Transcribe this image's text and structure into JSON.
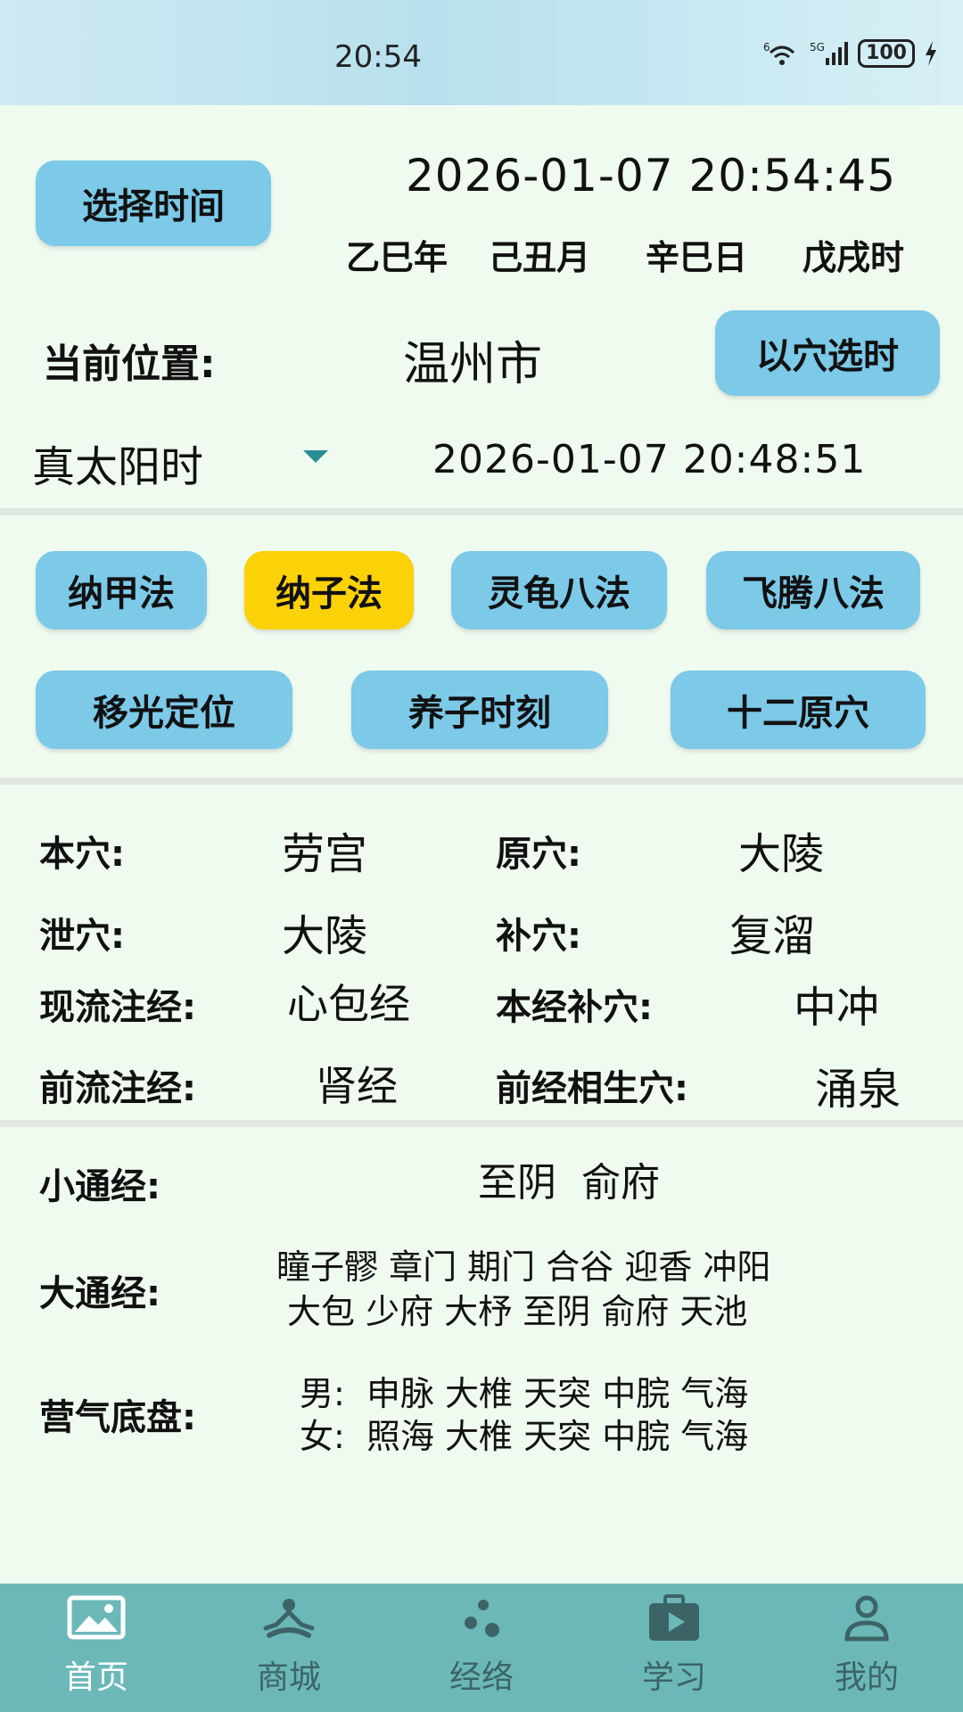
{
  "status": {
    "time": "20:54",
    "network": "5G",
    "wifi": "6",
    "battery": "100"
  },
  "header": {
    "select_time_button": "选择时间",
    "datetime": "2026-01-07 20:54:45",
    "ganzhi": [
      "乙巳年",
      "己丑月",
      "辛巳日",
      "戊戌时"
    ],
    "location_label": "当前位置:",
    "location_value": "温州市",
    "select_by_point_button": "以穴选时",
    "time_mode": "真太阳时",
    "solar_datetime": "2026-01-07 20:48:51"
  },
  "methods": {
    "row1": [
      "纳甲法",
      "纳子法",
      "灵龟八法",
      "飞腾八法"
    ],
    "row2": [
      "移光定位",
      "养子时刻",
      "十二原穴"
    ],
    "selected": "纳子法"
  },
  "points": [
    {
      "label": "本穴:",
      "value": "劳宫",
      "label2": "原穴:",
      "value2": "大陵"
    },
    {
      "label": "泄穴:",
      "value": "大陵",
      "label2": "补穴:",
      "value2": "复溜"
    },
    {
      "label": "现流注经:",
      "value": "心包经",
      "label2": "本经补穴:",
      "value2": "中冲"
    },
    {
      "label": "前流注经:",
      "value": "肾经",
      "label2": "前经相生穴:",
      "value2": "涌泉"
    }
  ],
  "meridians": {
    "small_label": "小通经:",
    "small_value": "至阴  俞府",
    "big_label": "大通经:",
    "big_line1": "瞳子髎 章门 期门 合谷 迎香 冲阳",
    "big_line2": "大包 少府 大杼 至阴 俞府 天池",
    "ying_label": "营气底盘:",
    "ying_male": "男:  申脉 大椎 天突 中脘 气海",
    "ying_female": "女:  照海 大椎 天突 中脘 气海"
  },
  "nav": [
    {
      "label": "首页",
      "icon": "home-image-icon",
      "active": true
    },
    {
      "label": "商城",
      "icon": "meditation-icon",
      "active": false
    },
    {
      "label": "经络",
      "icon": "dots-icon",
      "active": false
    },
    {
      "label": "学习",
      "icon": "play-briefcase-icon",
      "active": false
    },
    {
      "label": "我的",
      "icon": "person-icon",
      "active": false
    }
  ],
  "colors": {
    "button": "#7cc9e8",
    "selected": "#fbd107",
    "nav_bg": "#6cb8b8",
    "bg": "#f0fbf0"
  }
}
